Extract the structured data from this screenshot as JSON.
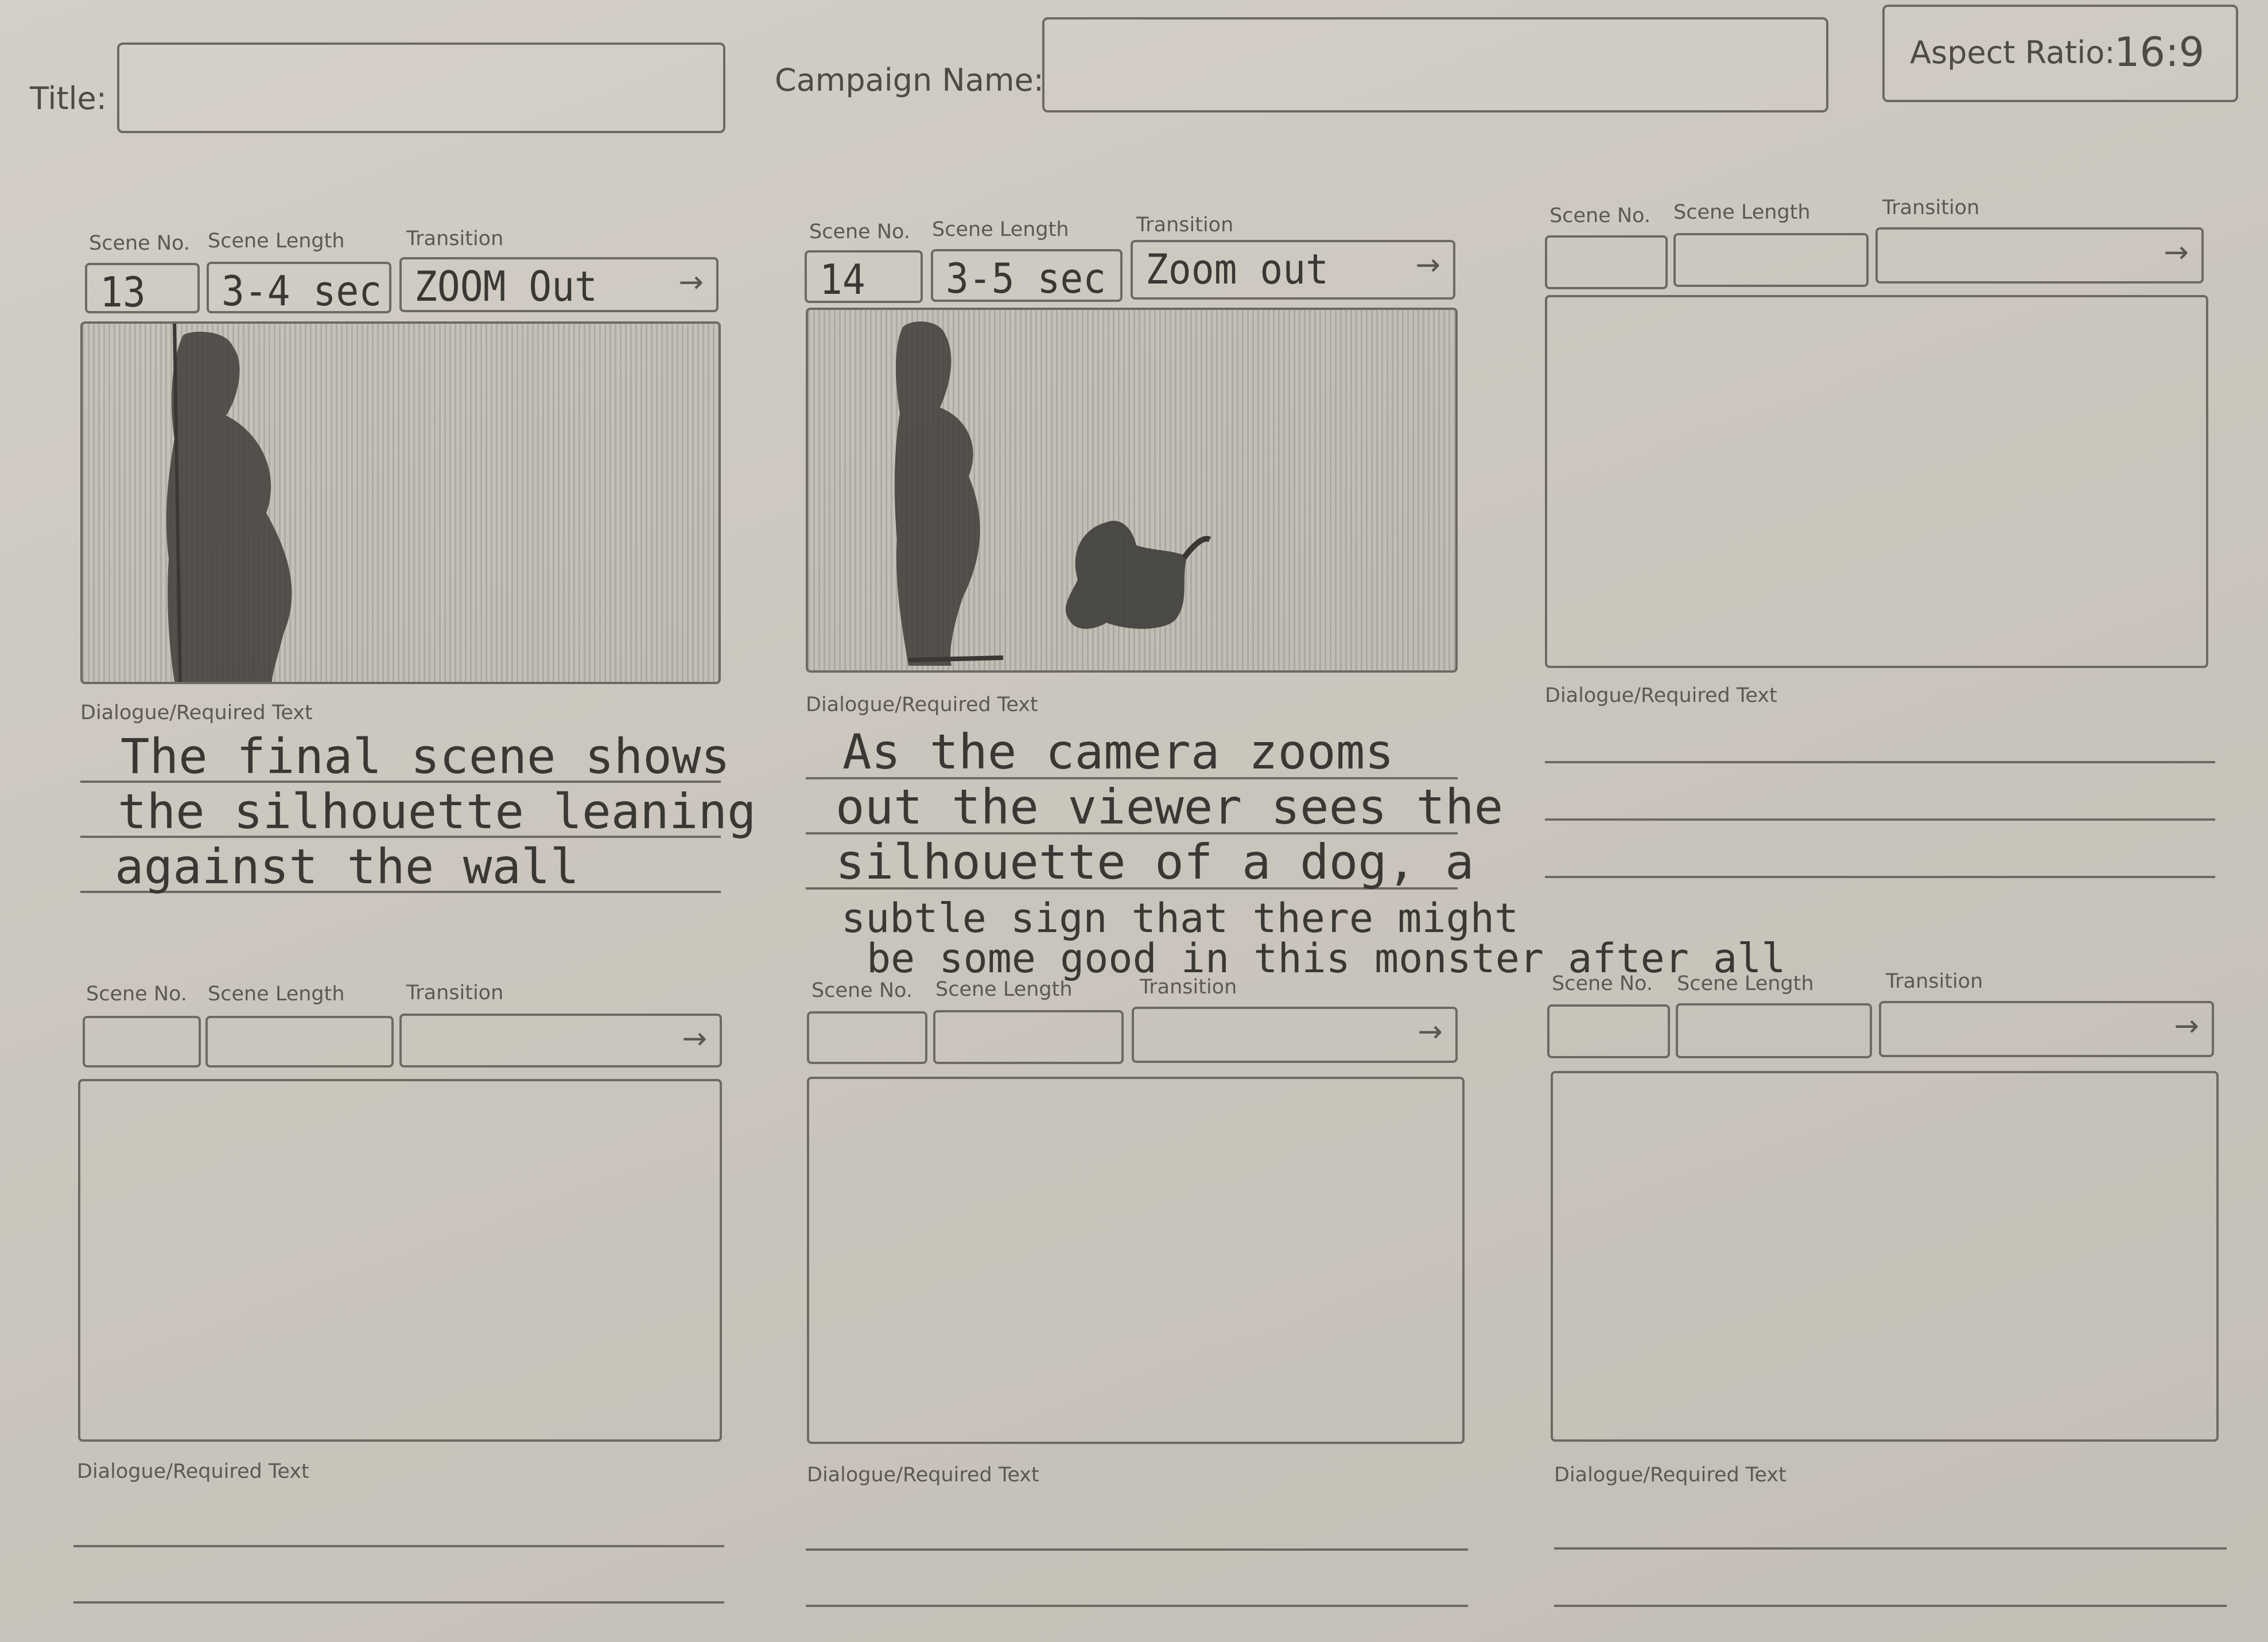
{
  "header": {
    "title_label": "Title:",
    "title_value": "",
    "campaign_label": "Campaign Name:",
    "campaign_value": "",
    "aspect_label": "Aspect Ratio:",
    "aspect_value": "16:9"
  },
  "labels": {
    "scene_no": "Scene No.",
    "scene_length": "Scene Length",
    "transition": "Transition",
    "dialogue": "Dialogue/Required Text",
    "arrow": "→"
  },
  "scenes": [
    {
      "scene_no": "13",
      "scene_length": "3-4 sec",
      "transition": "ZOOM Out",
      "dialogue": [
        "The final scene shows",
        "the silhouette leaning",
        "against the wall"
      ]
    },
    {
      "scene_no": "14",
      "scene_length": "3-5 sec",
      "transition": "Zoom out",
      "dialogue": [
        "As the camera zooms",
        "out the viewer sees the",
        "silhouette of a dog, a",
        "subtle sign that there might",
        "be some good in this monster after all"
      ]
    },
    {
      "scene_no": "",
      "scene_length": "",
      "transition": "",
      "dialogue": []
    },
    {
      "scene_no": "",
      "scene_length": "",
      "transition": "",
      "dialogue": []
    },
    {
      "scene_no": "",
      "scene_length": "",
      "transition": "",
      "dialogue": []
    },
    {
      "scene_no": "",
      "scene_length": "",
      "transition": "",
      "dialogue": []
    }
  ]
}
